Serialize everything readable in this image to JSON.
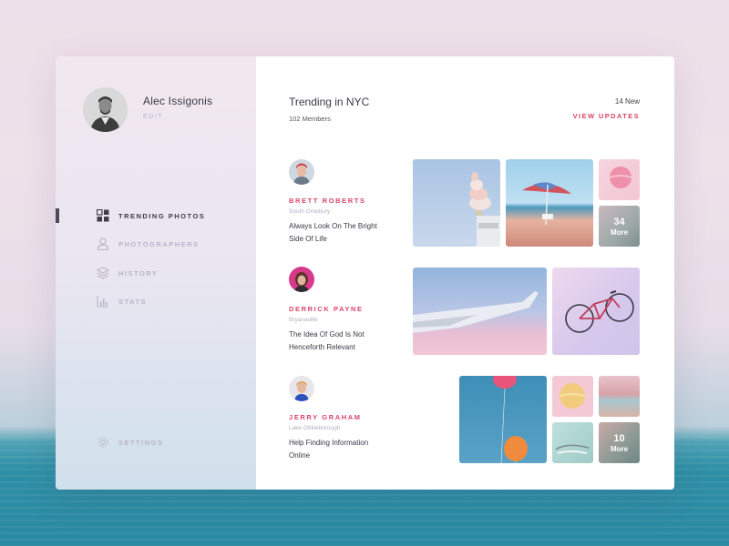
{
  "profile": {
    "name": "Alec Issigonis",
    "edit_label": "EDIT"
  },
  "nav": {
    "items": [
      {
        "label": "TRENDING PHOTOS",
        "icon": "grid-icon",
        "active": true
      },
      {
        "label": "PHOTOGRAPHERS",
        "icon": "user-icon",
        "active": false
      },
      {
        "label": "HISTORY",
        "icon": "layers-icon",
        "active": false
      },
      {
        "label": "STATS",
        "icon": "bar-chart-icon",
        "active": false
      }
    ],
    "settings_label": "SETTINGS"
  },
  "header": {
    "title": "Trending in NYC",
    "members": "102 Members",
    "new_count": "14 New",
    "view_updates": "VIEW UPDATES"
  },
  "users": [
    {
      "name": "BRETT ROBERTS",
      "location": "South Oniebury",
      "quote": "Always Look On The Bright Side Of Life",
      "more": {
        "count": "34",
        "label": "More"
      }
    },
    {
      "name": "DERRICK PAYNE",
      "location": "Bryanaville",
      "quote": "The Idea Of God Is Not Henceforth Relevant"
    },
    {
      "name": "JERRY GRAHAM",
      "location": "Lake Ottilieborough",
      "quote": "Help Finding Information Online",
      "more": {
        "count": "10",
        "label": "More"
      }
    }
  ],
  "colors": {
    "accent": "#d8456a",
    "text_dark": "#3a3a46",
    "muted": "#b9b5c6"
  }
}
